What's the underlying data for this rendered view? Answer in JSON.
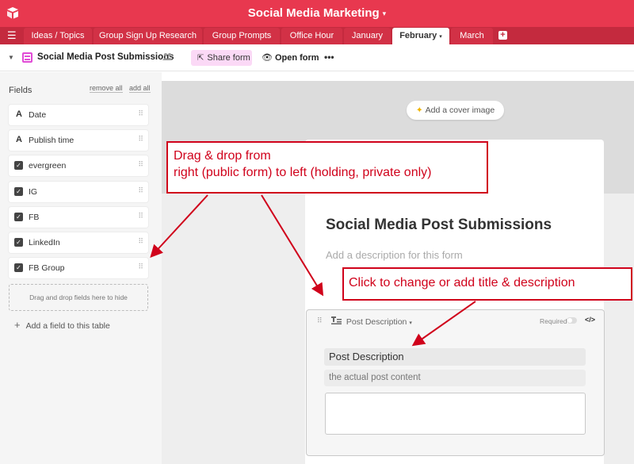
{
  "topbar": {
    "base_title": "Social Media Marketing",
    "caret": "▾",
    "brand_color": "#e8384f"
  },
  "tabs": {
    "items": [
      {
        "label": "Ideas / Topics"
      },
      {
        "label": "Group Sign Up Research"
      },
      {
        "label": "Group Prompts"
      },
      {
        "label": "Office Hour"
      },
      {
        "label": "January"
      },
      {
        "label": "February",
        "active": true
      },
      {
        "label": "March"
      }
    ],
    "active_caret": "▾",
    "add_symbol": "+"
  },
  "viewbar": {
    "view_name": "Social Media Post Submissions",
    "share_label": "Share form",
    "open_label": "Open form",
    "more_label": "•••",
    "form_icon_color": "#e14bd6"
  },
  "sidebar": {
    "fields_label": "Fields",
    "remove_all": "remove all",
    "add_all": "add all",
    "fields": [
      {
        "label": "Date",
        "type": "text"
      },
      {
        "label": "Publish time",
        "type": "text"
      },
      {
        "label": "evergreen",
        "type": "checkbox"
      },
      {
        "label": "IG",
        "type": "checkbox"
      },
      {
        "label": "FB",
        "type": "checkbox"
      },
      {
        "label": "LinkedIn",
        "type": "checkbox"
      },
      {
        "label": "FB Group",
        "type": "checkbox"
      }
    ],
    "text_type_glyph": "A",
    "check_glyph": "✓",
    "grip_glyph": "⠿",
    "drop_zone": "Drag and drop fields here to hide",
    "add_field": "Add a field to this table"
  },
  "form": {
    "cover_button": "Add a cover image",
    "title": "Social Media Post Submissions",
    "description_placeholder": "Add a description for this form",
    "field_card": {
      "type_label": "Post Description",
      "required_label": "Required",
      "field_label": "Post Description",
      "help_text": "the actual post content",
      "code_glyph": "</>"
    }
  },
  "annotations": {
    "callout1_line1": "Drag & drop from",
    "callout1_line2": "right (public form) to left (holding, private only)",
    "callout2": "Click to change or add title & description",
    "color": "#d0021b"
  }
}
